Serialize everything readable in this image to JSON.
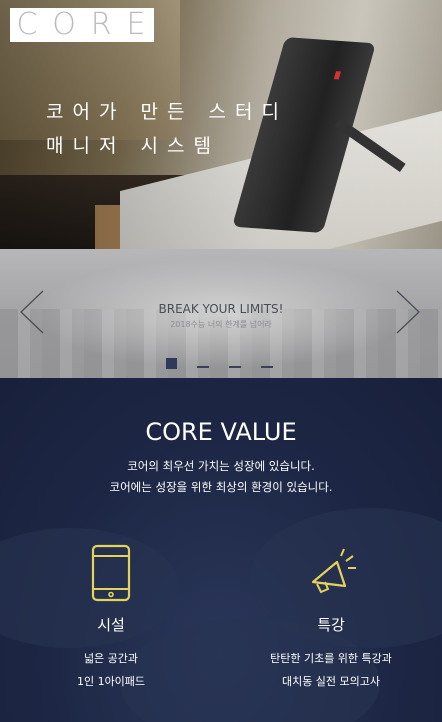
{
  "hero": {
    "logo_letters": [
      "C",
      "O",
      "R",
      "E"
    ],
    "title_line1": "코어가 만든 스터디",
    "title_line2": "매니저 시스템"
  },
  "banner": {
    "title": "BREAK YOUR LIMITS!",
    "subtitle": "2018수능 너의 한계를 넘어라",
    "slides": 4,
    "active_slide": 1
  },
  "core_value": {
    "heading": "CORE VALUE",
    "desc_line1": "코어의 최우선 가치는 성장에 있습니다.",
    "desc_line2": "코어에는 성장을 위한 최상의 환경이 있습니다.",
    "features": [
      {
        "icon": "tablet-icon",
        "title": "시설",
        "line1": "넓은 공간과",
        "line2": "1인 1아이패드"
      },
      {
        "icon": "megaphone-icon",
        "title": "특강",
        "line1": "탄탄한 기초를 위한 특강과",
        "line2": "대치동 실전 모의고사"
      }
    ]
  },
  "colors": {
    "navy": "#1b2540",
    "accent_yellow": "#e3d35a"
  }
}
